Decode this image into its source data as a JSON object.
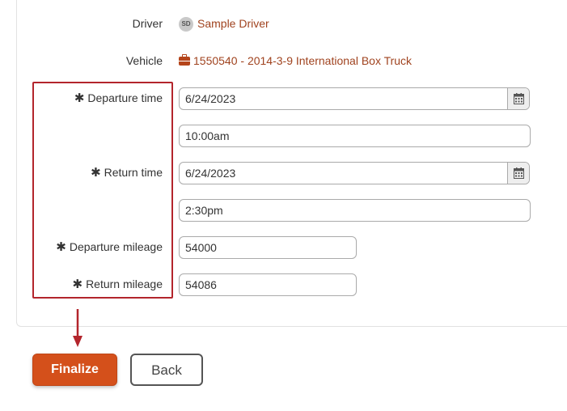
{
  "form": {
    "driver": {
      "label": "Driver",
      "avatar_initials": "SD",
      "value": "Sample Driver"
    },
    "vehicle": {
      "label": "Vehicle",
      "value": "1550540 - 2014-3-9 International Box Truck"
    },
    "departure_time": {
      "label": "Departure time",
      "required_mark": "✱",
      "date": "6/24/2023",
      "time": "10:00am"
    },
    "return_time": {
      "label": "Return time",
      "required_mark": "✱",
      "date": "6/24/2023",
      "time": "2:30pm"
    },
    "departure_mileage": {
      "label": "Departure mileage",
      "required_mark": "✱",
      "value": "54000"
    },
    "return_mileage": {
      "label": "Return mileage",
      "required_mark": "✱",
      "value": "54086"
    }
  },
  "actions": {
    "finalize_label": "Finalize",
    "back_label": "Back"
  },
  "annotation": {
    "highlight_color": "#b3252c"
  },
  "colors": {
    "accent": "#d4501b",
    "link": "#a0431f"
  }
}
